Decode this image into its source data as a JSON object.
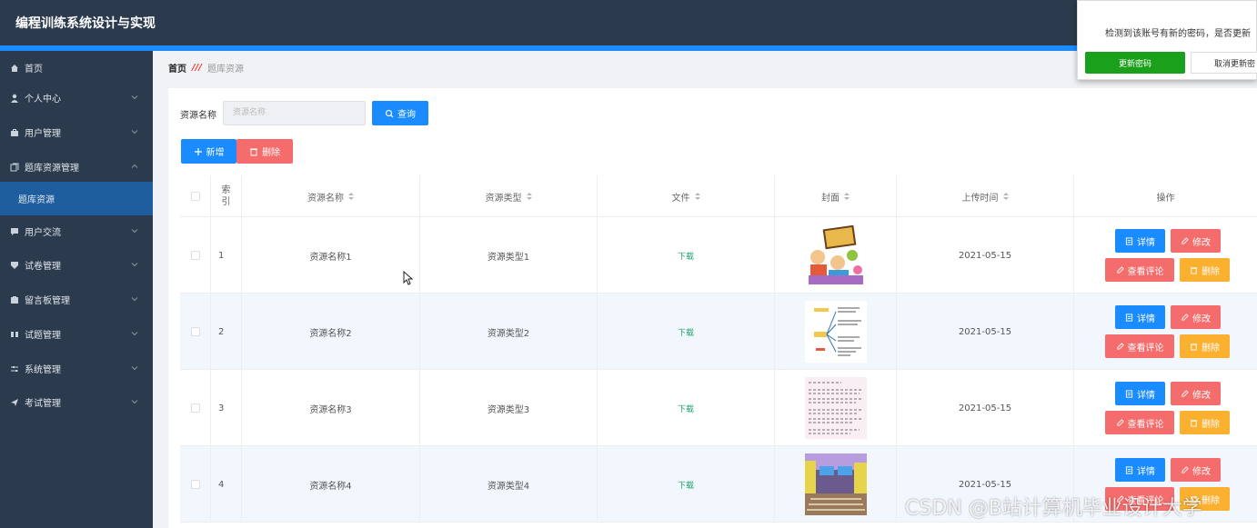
{
  "app": {
    "title": "编程训练系统设计与实现"
  },
  "sidebar": {
    "items": [
      {
        "label": "首页",
        "icon": "home-icon",
        "chevron": false
      },
      {
        "label": "个人中心",
        "icon": "user-icon",
        "chevron": "down"
      },
      {
        "label": "用户管理",
        "icon": "briefcase-icon",
        "chevron": "down"
      },
      {
        "label": "题库资源管理",
        "icon": "copy-icon",
        "chevron": "up"
      },
      {
        "label": "题库资源",
        "icon": "",
        "chevron": false,
        "active": true
      },
      {
        "label": "用户交流",
        "icon": "chat-icon",
        "chevron": "down"
      },
      {
        "label": "试卷管理",
        "icon": "shield-icon",
        "chevron": "down"
      },
      {
        "label": "留言板管理",
        "icon": "board-icon",
        "chevron": "down"
      },
      {
        "label": "试题管理",
        "icon": "rows-icon",
        "chevron": "down"
      },
      {
        "label": "系统管理",
        "icon": "sliders-icon",
        "chevron": "down"
      },
      {
        "label": "考试管理",
        "icon": "send-icon",
        "chevron": "down"
      }
    ]
  },
  "breadcrumb": {
    "home": "首页",
    "current": "题库资源"
  },
  "search": {
    "label": "资源名称",
    "placeholder": "资源名称",
    "button": "查询"
  },
  "toolbar": {
    "add": "新增",
    "delete": "删除"
  },
  "table": {
    "headers": {
      "index": "索引",
      "name": "资源名称",
      "type": "资源类型",
      "file": "文件",
      "cover": "封面",
      "time": "上传时间",
      "ops": "操作"
    },
    "rows": [
      {
        "index": "1",
        "name": "资源名称1",
        "type": "资源类型1",
        "file": "下载",
        "cover": "cartoon-kids-image",
        "time": "2021-05-15"
      },
      {
        "index": "2",
        "name": "资源名称2",
        "type": "资源类型2",
        "file": "下载",
        "cover": "mindmap-image",
        "time": "2021-05-15"
      },
      {
        "index": "3",
        "name": "资源名称3",
        "type": "资源类型3",
        "file": "下载",
        "cover": "document-image",
        "time": "2021-05-15"
      },
      {
        "index": "4",
        "name": "资源名称4",
        "type": "资源类型4",
        "file": "下载",
        "cover": "classroom-image",
        "time": "2021-05-15"
      }
    ],
    "actions": {
      "detail": "详情",
      "edit": "修改",
      "comments": "查看评论",
      "delete": "删除"
    }
  },
  "popup": {
    "message": "检测到该账号有新的密码，是否更新",
    "update": "更新密码",
    "cancel": "取消更新密"
  },
  "watermark": "CSDN @B站计算机毕业设计大学",
  "colors": {
    "primary": "#1a8cff",
    "danger": "#f56c6c",
    "warning": "#fbb030",
    "sidebar": "#2b3a4c",
    "success": "#1aa01a"
  }
}
